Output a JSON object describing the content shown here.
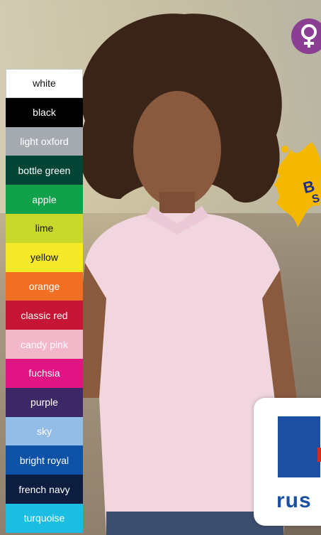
{
  "swatches": [
    {
      "label": "white",
      "color": "#ffffff",
      "text": "#111111"
    },
    {
      "label": "black",
      "color": "#000000",
      "text": "#ffffff"
    },
    {
      "label": "light oxford",
      "color": "#a5aab1",
      "text": "#ffffff"
    },
    {
      "label": "bottle green",
      "color": "#024534",
      "text": "#ffffff"
    },
    {
      "label": "apple",
      "color": "#11a14a",
      "text": "#ffffff"
    },
    {
      "label": "lime",
      "color": "#c9d92c",
      "text": "#111111"
    },
    {
      "label": "yellow",
      "color": "#f6e92a",
      "text": "#111111"
    },
    {
      "label": "orange",
      "color": "#f06f22",
      "text": "#ffffff"
    },
    {
      "label": "classic red",
      "color": "#c51535",
      "text": "#ffffff"
    },
    {
      "label": "candy pink",
      "color": "#f2b7c9",
      "text": "#ffffff"
    },
    {
      "label": "fuchsia",
      "color": "#e01482",
      "text": "#ffffff"
    },
    {
      "label": "purple",
      "color": "#3c2767",
      "text": "#ffffff"
    },
    {
      "label": "sky",
      "color": "#93bce6",
      "text": "#ffffff"
    },
    {
      "label": "bright royal",
      "color": "#0d52a6",
      "text": "#ffffff"
    },
    {
      "label": "french navy",
      "color": "#0d1d40",
      "text": "#ffffff"
    },
    {
      "label": "turquoise",
      "color": "#1bbde2",
      "text": "#ffffff"
    }
  ],
  "badge": {
    "text_line1": "B",
    "text_line2": "S"
  },
  "gender_icon": "female-symbol-icon",
  "brand": {
    "text": "rus"
  },
  "colors": {
    "accent": "#8a3f93",
    "brand_blue": "#1c4ea1",
    "brand_red": "#d52b1e",
    "splash": "#f5b800"
  }
}
